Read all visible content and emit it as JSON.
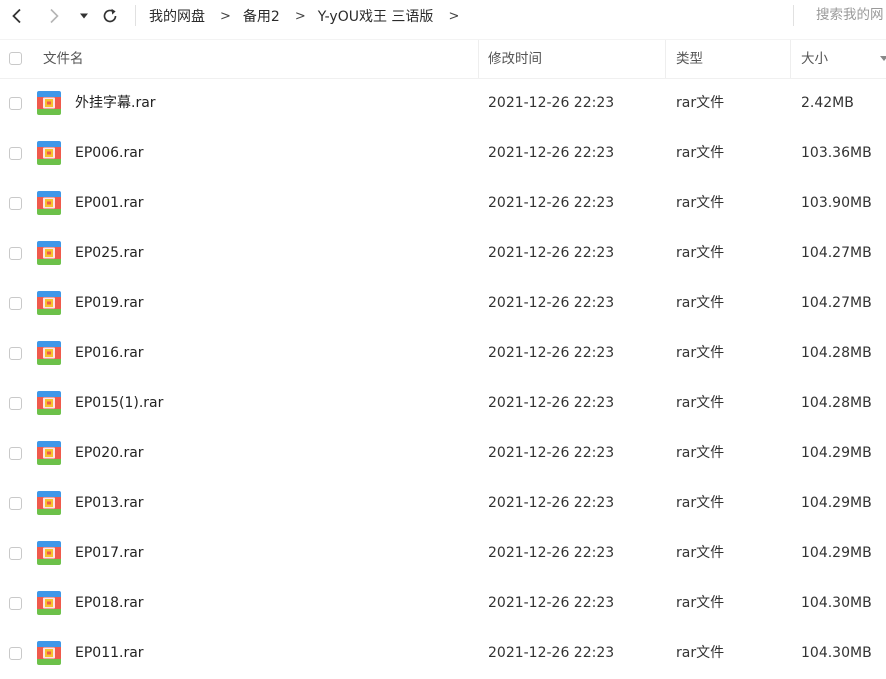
{
  "toolbar": {
    "breadcrumb": [
      "我的网盘",
      "备用2",
      "Y-yOU戏王 三语版"
    ],
    "breadcrumb_separator": ">",
    "search_placeholder": "搜索我的网"
  },
  "table": {
    "columns": {
      "name": "文件名",
      "modified": "修改时间",
      "type": "类型",
      "size": "大小"
    },
    "rows": [
      {
        "name": "外挂字幕.rar",
        "modified": "2021-12-26 22:23",
        "type": "rar文件",
        "size": "2.42MB"
      },
      {
        "name": "EP006.rar",
        "modified": "2021-12-26 22:23",
        "type": "rar文件",
        "size": "103.36MB"
      },
      {
        "name": "EP001.rar",
        "modified": "2021-12-26 22:23",
        "type": "rar文件",
        "size": "103.90MB"
      },
      {
        "name": "EP025.rar",
        "modified": "2021-12-26 22:23",
        "type": "rar文件",
        "size": "104.27MB"
      },
      {
        "name": "EP019.rar",
        "modified": "2021-12-26 22:23",
        "type": "rar文件",
        "size": "104.27MB"
      },
      {
        "name": "EP016.rar",
        "modified": "2021-12-26 22:23",
        "type": "rar文件",
        "size": "104.28MB"
      },
      {
        "name": "EP015(1).rar",
        "modified": "2021-12-26 22:23",
        "type": "rar文件",
        "size": "104.28MB"
      },
      {
        "name": "EP020.rar",
        "modified": "2021-12-26 22:23",
        "type": "rar文件",
        "size": "104.29MB"
      },
      {
        "name": "EP013.rar",
        "modified": "2021-12-26 22:23",
        "type": "rar文件",
        "size": "104.29MB"
      },
      {
        "name": "EP017.rar",
        "modified": "2021-12-26 22:23",
        "type": "rar文件",
        "size": "104.29MB"
      },
      {
        "name": "EP018.rar",
        "modified": "2021-12-26 22:23",
        "type": "rar文件",
        "size": "104.30MB"
      },
      {
        "name": "EP011.rar",
        "modified": "2021-12-26 22:23",
        "type": "rar文件",
        "size": "104.30MB"
      }
    ]
  },
  "icons": {
    "back": "chevron-left-icon",
    "forward": "chevron-right-icon",
    "history": "caret-down-icon",
    "refresh": "refresh-icon",
    "file": "rar-archive-icon"
  },
  "colors": {
    "archive_red": "#ef5a4c",
    "archive_blue": "#3e97e8",
    "archive_green": "#6cc14a",
    "archive_yellow": "#f6c32e"
  }
}
